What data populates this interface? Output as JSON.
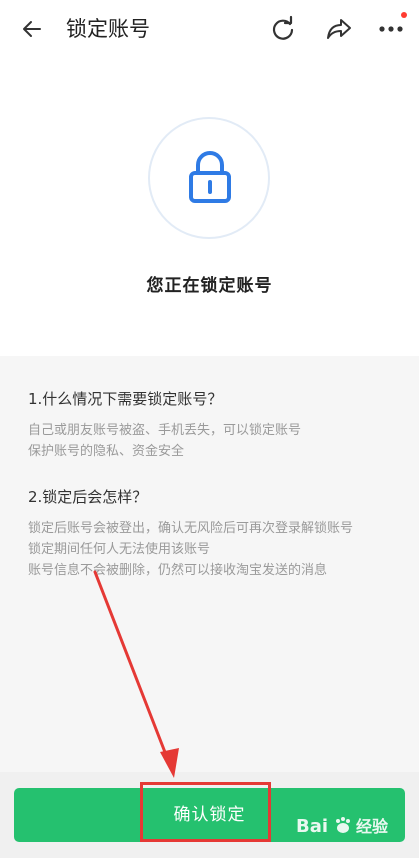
{
  "header": {
    "title": "锁定账号",
    "back_icon": "arrow-left-icon",
    "refresh_icon": "refresh-icon",
    "share_icon": "share-icon",
    "more_icon": "more-dots-icon",
    "badge_color": "#ff3b30"
  },
  "hero": {
    "icon": "lock-icon",
    "icon_color": "#2f7be5",
    "status_text": "您正在锁定账号"
  },
  "info": {
    "sections": [
      {
        "title": "1.什么情况下需要锁定账号？",
        "lines": [
          "自己或朋友账号被盗、手机丢失，可以锁定账号",
          "保护账号的隐私、资金安全"
        ]
      },
      {
        "title": "2.锁定后会怎样？",
        "lines": [
          "锁定后账号会被登出，确认无风险后可再次登录解锁账号",
          "锁定期间任何人无法使用该账号",
          "账号信息不会被删除，仍然可以接收淘宝发送的消息"
        ]
      }
    ]
  },
  "bottom": {
    "confirm_label": "确认锁定",
    "button_color": "#25c16f"
  },
  "annotation": {
    "color": "#e53935"
  },
  "watermark": {
    "text": "Bai",
    "suffix": "经验"
  }
}
